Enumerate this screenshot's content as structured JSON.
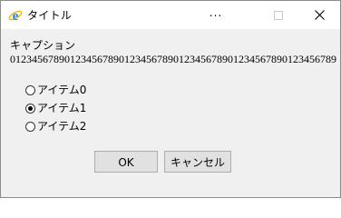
{
  "window": {
    "title": "タイトル",
    "minimize_label": "...",
    "icon": "internet-explorer-icon"
  },
  "content": {
    "caption": "キャプション",
    "digits": "012345678901234567890123456789012345678901234567890123456789"
  },
  "radios": [
    {
      "label": "アイテム0",
      "checked": false
    },
    {
      "label": "アイテム1",
      "checked": true
    },
    {
      "label": "アイテム2",
      "checked": false
    }
  ],
  "buttons": {
    "ok": "OK",
    "cancel": "キャンセル"
  },
  "colors": {
    "window_bg": "#f0f0f0",
    "titlebar_bg": "#ffffff",
    "button_bg": "#e1e1e1",
    "button_border": "#adadad",
    "ie_blue": "#1e88e5",
    "ie_gold": "#f5b400"
  }
}
